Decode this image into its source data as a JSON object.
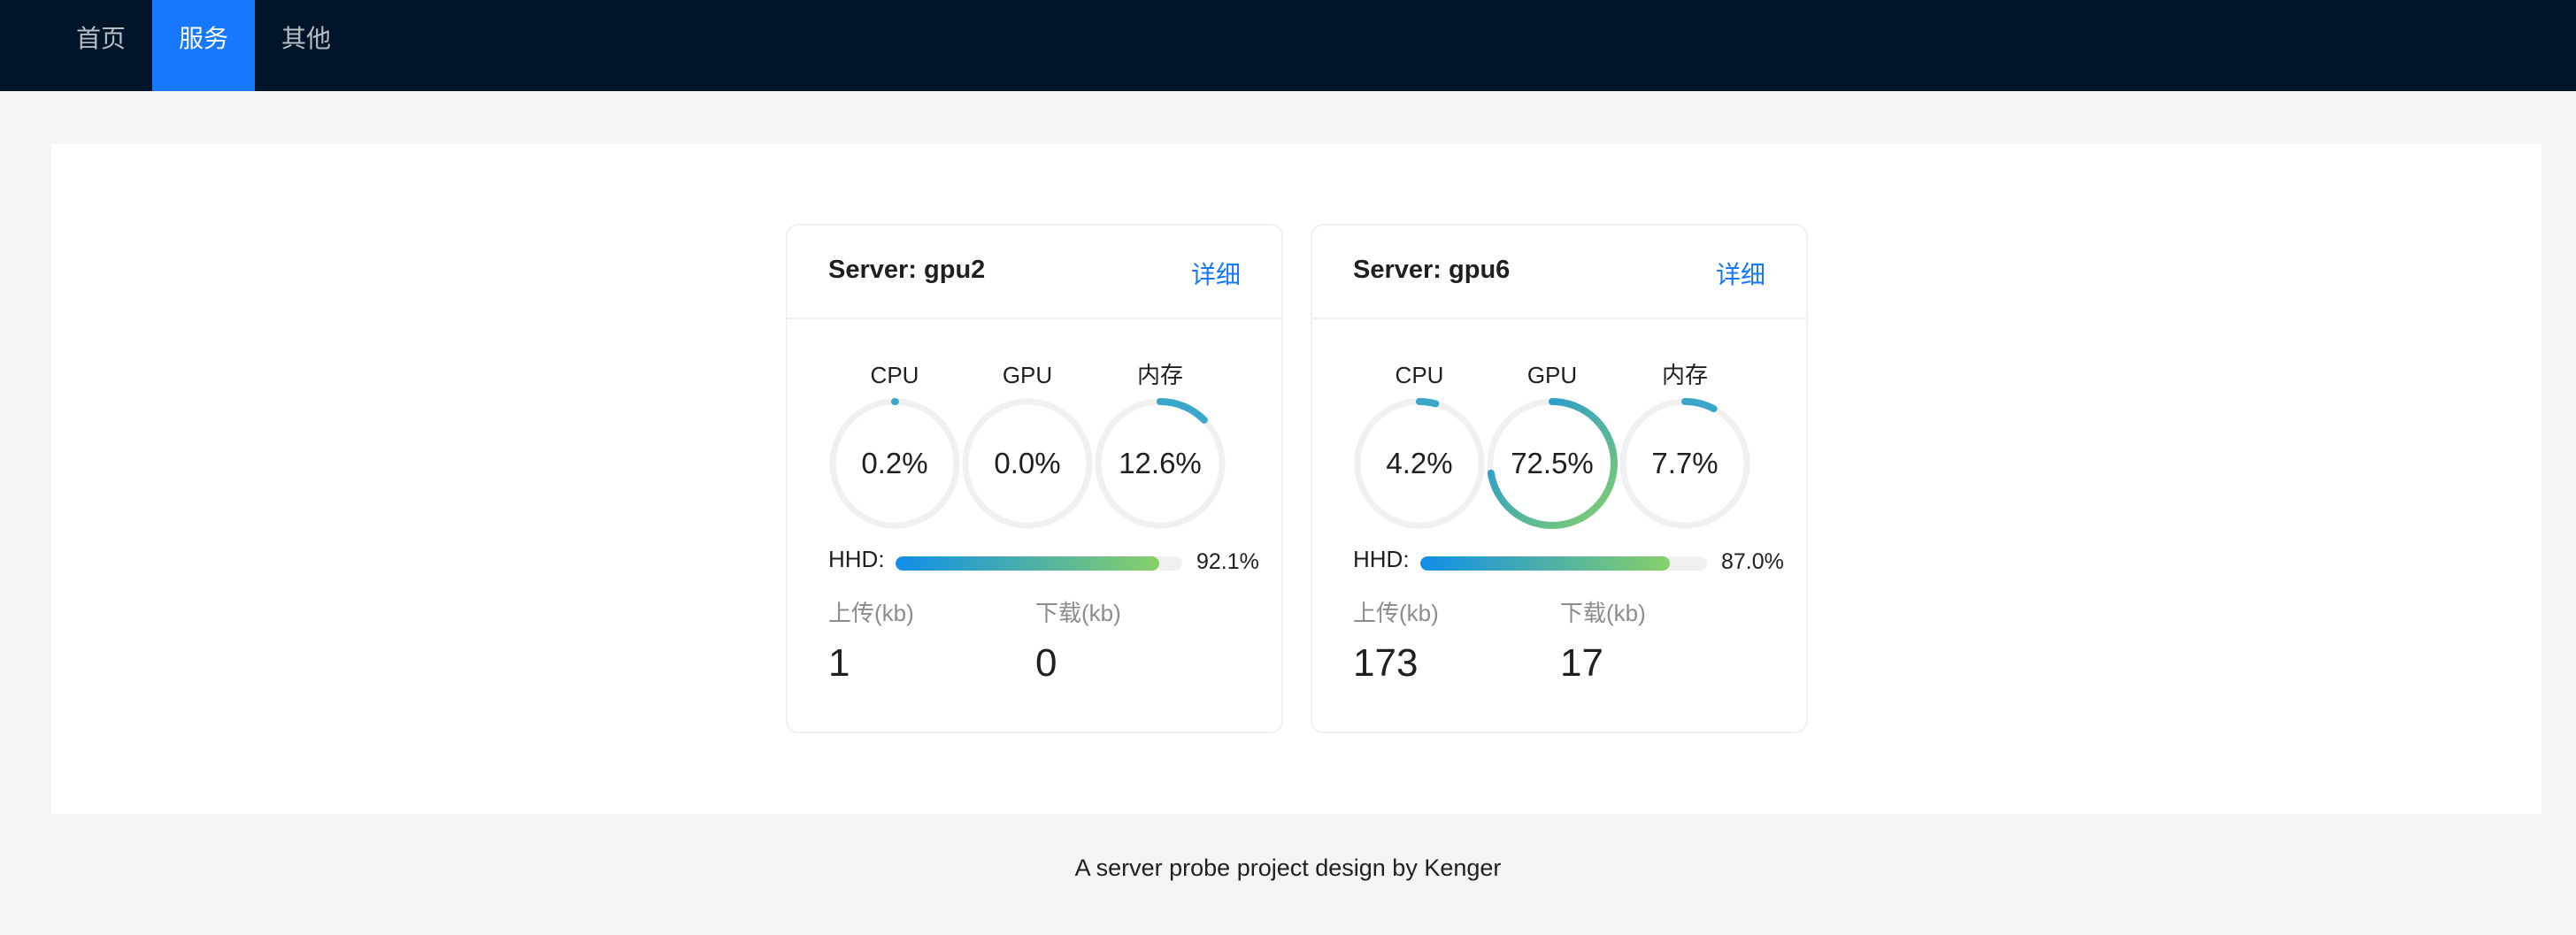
{
  "nav": {
    "items": [
      {
        "label": "首页",
        "active": false
      },
      {
        "label": "服务",
        "active": true
      },
      {
        "label": "其他",
        "active": false
      }
    ]
  },
  "colors": {
    "header_bg": "#001529",
    "accent": "#1677ff",
    "gauge_start": "#87d068",
    "gauge_end": "#108ee9",
    "track": "#f0f0f0"
  },
  "servers": [
    {
      "title": "Server: gpu2",
      "detail_label": "详细",
      "gauges": [
        {
          "label": "CPU",
          "value": "0.2%",
          "percent": 0.2
        },
        {
          "label": "GPU",
          "value": "0.0%",
          "percent": 0.0
        },
        {
          "label": "内存",
          "value": "12.6%",
          "percent": 12.6
        }
      ],
      "hhd_label": "HHD:",
      "hhd_value": "92.1%",
      "hhd_percent": 92.1,
      "upload_label": "上传(kb)",
      "upload_value": "1",
      "download_label": "下载(kb)",
      "download_value": "0"
    },
    {
      "title": "Server: gpu6",
      "detail_label": "详细",
      "gauges": [
        {
          "label": "CPU",
          "value": "4.2%",
          "percent": 4.2
        },
        {
          "label": "GPU",
          "value": "72.5%",
          "percent": 72.5
        },
        {
          "label": "内存",
          "value": "7.7%",
          "percent": 7.7
        }
      ],
      "hhd_label": "HHD:",
      "hhd_value": "87.0%",
      "hhd_percent": 87.0,
      "upload_label": "上传(kb)",
      "upload_value": "173",
      "download_label": "下载(kb)",
      "download_value": "17"
    }
  ],
  "footer": {
    "text": "A server probe project design by Kenger"
  }
}
